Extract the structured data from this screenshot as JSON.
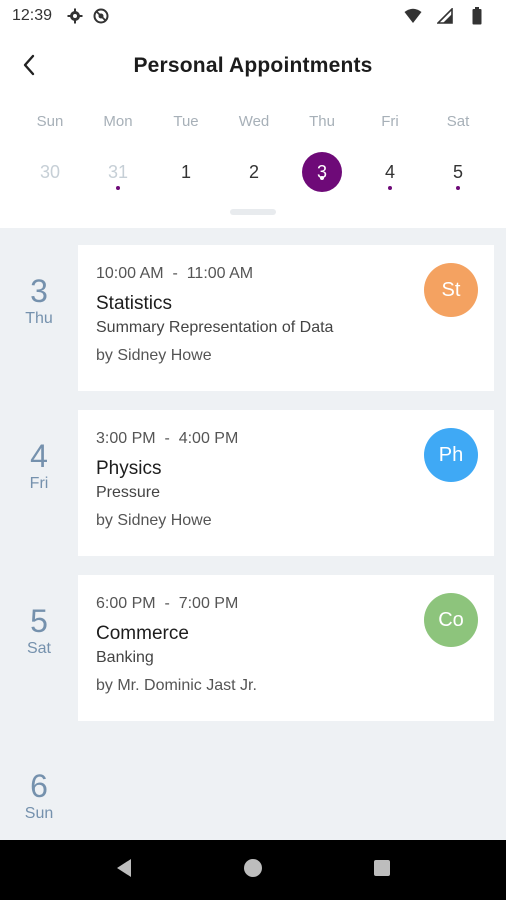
{
  "status_bar": {
    "time": "12:39",
    "icons": [
      "gear-icon",
      "sync-icon",
      "wifi-icon",
      "signal-icon",
      "battery-icon"
    ]
  },
  "app_bar": {
    "title": "Personal Appointments",
    "back_icon": "chevron-left-icon"
  },
  "week": {
    "days": [
      {
        "dow": "Sun",
        "num": "30",
        "state": "faded",
        "dot": false
      },
      {
        "dow": "Mon",
        "num": "31",
        "state": "faded",
        "dot": true
      },
      {
        "dow": "Tue",
        "num": "1",
        "state": "normal",
        "dot": false
      },
      {
        "dow": "Wed",
        "num": "2",
        "state": "normal",
        "dot": false
      },
      {
        "dow": "Thu",
        "num": "3",
        "state": "selected",
        "dot": true
      },
      {
        "dow": "Fri",
        "num": "4",
        "state": "normal",
        "dot": true
      },
      {
        "dow": "Sat",
        "num": "5",
        "state": "normal",
        "dot": true
      }
    ],
    "accent": "#6e0a78"
  },
  "appointments": [
    {
      "day_num": "3",
      "day_name": "Thu",
      "time": "10:00 AM  -  11:00 AM",
      "subject": "Statistics",
      "topic": "Summary Representation of Data",
      "by": "by Sidney Howe",
      "initials": "St",
      "color": "#f4a261"
    },
    {
      "day_num": "4",
      "day_name": "Fri",
      "time": "3:00 PM  -  4:00 PM",
      "subject": "Physics",
      "topic": "Pressure",
      "by": "by Sidney Howe",
      "initials": "Ph",
      "color": "#3fa9f5"
    },
    {
      "day_num": "5",
      "day_name": "Sat",
      "time": "6:00 PM  -  7:00 PM",
      "subject": "Commerce",
      "topic": "Banking",
      "by": "by Mr. Dominic Jast Jr.",
      "initials": "Co",
      "color": "#8dc47c"
    }
  ],
  "trailing_day": {
    "day_num": "6",
    "day_name": "Sun"
  },
  "nav_bar": {
    "icons": [
      "back-triangle-icon",
      "home-circle-icon",
      "recents-square-icon"
    ]
  }
}
